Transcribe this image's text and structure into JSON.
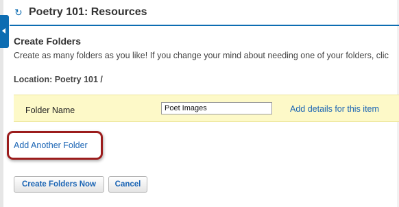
{
  "header": {
    "title": "Poetry 101: Resources",
    "reload_icon": "↻"
  },
  "section": {
    "title": "Create Folders",
    "intro": "Create as many folders as you like! If you change your mind about needing one of your folders, clic"
  },
  "location": {
    "text": "Location: Poetry 101 /"
  },
  "folder_row": {
    "label": "Folder Name",
    "input_value": "Poet Images",
    "details_link": "Add details for this item"
  },
  "add_another": {
    "label": "Add Another Folder"
  },
  "buttons": {
    "create": "Create Folders Now",
    "cancel": "Cancel"
  },
  "colors": {
    "accent": "#0d6db2",
    "link": "#1a64b4",
    "row_bg": "#fdf9c8",
    "highlight": "#9b1c1c"
  }
}
